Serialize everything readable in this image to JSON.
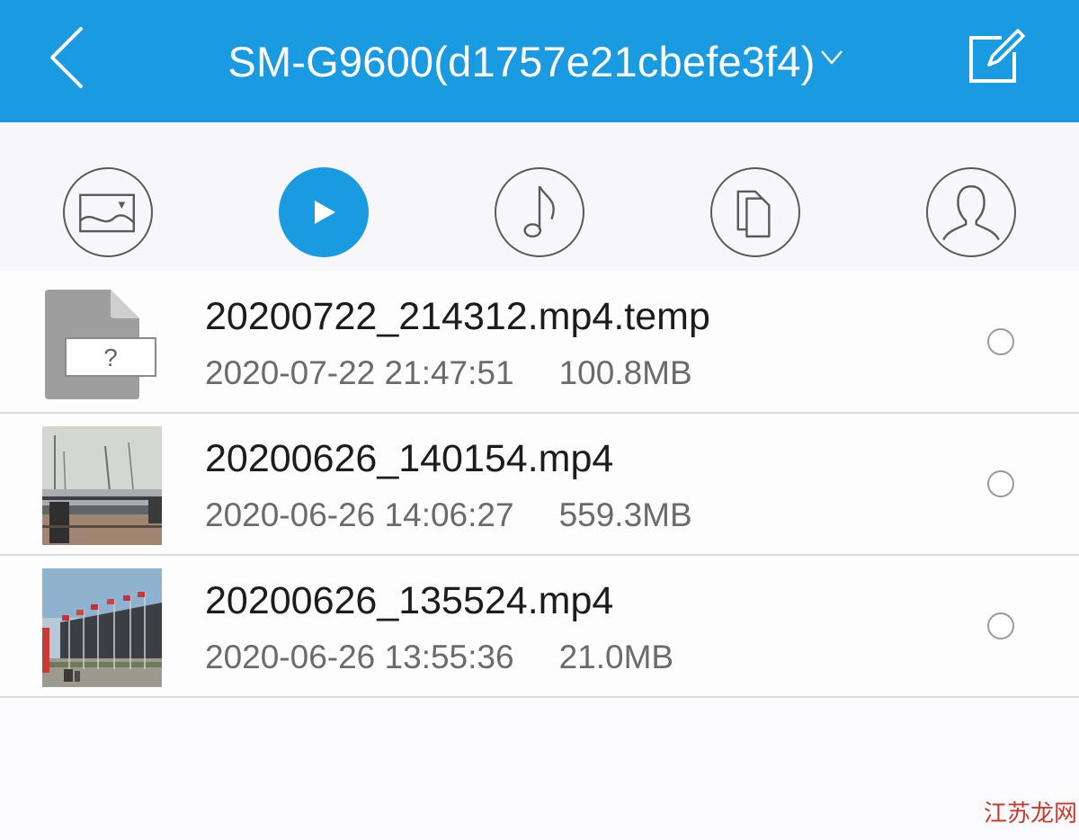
{
  "header": {
    "title": "SM-G9600(d1757e21cbefe3f4)",
    "back_icon": "chevron-left-icon",
    "dropdown_icon": "chevron-down-icon",
    "edit_icon": "edit-icon",
    "background_color": "#1a9ae0"
  },
  "tabs": [
    {
      "icon": "image-icon",
      "active": false
    },
    {
      "icon": "play-icon",
      "active": true
    },
    {
      "icon": "music-note-icon",
      "active": false
    },
    {
      "icon": "documents-icon",
      "active": false
    },
    {
      "icon": "person-icon",
      "active": false
    }
  ],
  "files": [
    {
      "name": "20200722_214312.mp4.temp",
      "date": "2020-07-22 21:47:51",
      "size": "100.8MB",
      "thumb": "unknown-file-icon",
      "selected": false
    },
    {
      "name": "20200626_140154.mp4",
      "date": "2020-06-26 14:06:27",
      "size": "559.3MB",
      "thumb": "harbor-video-thumbnail",
      "selected": false
    },
    {
      "name": "20200626_135524.mp4",
      "date": "2020-06-26 13:55:36",
      "size": "21.0MB",
      "thumb": "flags-building-video-thumbnail",
      "selected": false
    }
  ],
  "watermark": "江苏龙网",
  "colors": {
    "accent": "#1a9ae0",
    "divider": "#dcdcde",
    "secondary_text": "#6b6b6b"
  }
}
